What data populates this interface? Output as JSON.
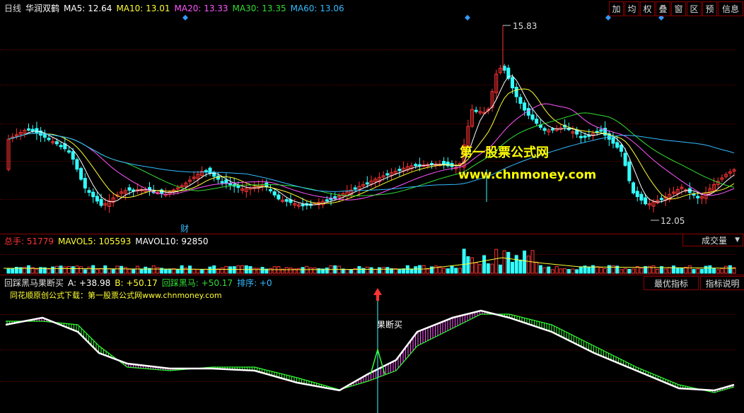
{
  "main": {
    "period": "日线",
    "stock": "华润双鹤",
    "ma": [
      {
        "label": "MA5: 12.64",
        "color": "#ffffff"
      },
      {
        "label": "MA10: 13.01",
        "color": "#ffff33"
      },
      {
        "label": "MA20: 13.33",
        "color": "#ff55ff"
      },
      {
        "label": "MA30: 13.35",
        "color": "#33dd33"
      },
      {
        "label": "MA60: 13.06",
        "color": "#33bbff"
      }
    ],
    "high_label": "15.83",
    "low_label": "12.05",
    "cai_label": "财",
    "watermark1": "第一股票公式网",
    "watermark2": "www.chnmoney.com"
  },
  "toolbar": [
    "加",
    "均",
    "权",
    "叠",
    "窗",
    "区",
    "预",
    "信息",
    "⇦"
  ],
  "volume": {
    "total": "总手: 51779",
    "mavol5": "MAVOL5: 105593",
    "mavol10": "MAVOL10: 92850",
    "dropdown": "成交量",
    "arrow": "▼"
  },
  "indicator": {
    "name": "回踩黑马果断买",
    "a": "A: +38.98",
    "b": "B: +50.17",
    "c": "回踩黑马: +50.17",
    "rank": "排序: +0",
    "best_button": "最优指标",
    "help_button": "指标说明",
    "source_line": "同花顺原创公式下载：第一股票公式网www.chnmoney.com",
    "signal": "果断买"
  }
}
